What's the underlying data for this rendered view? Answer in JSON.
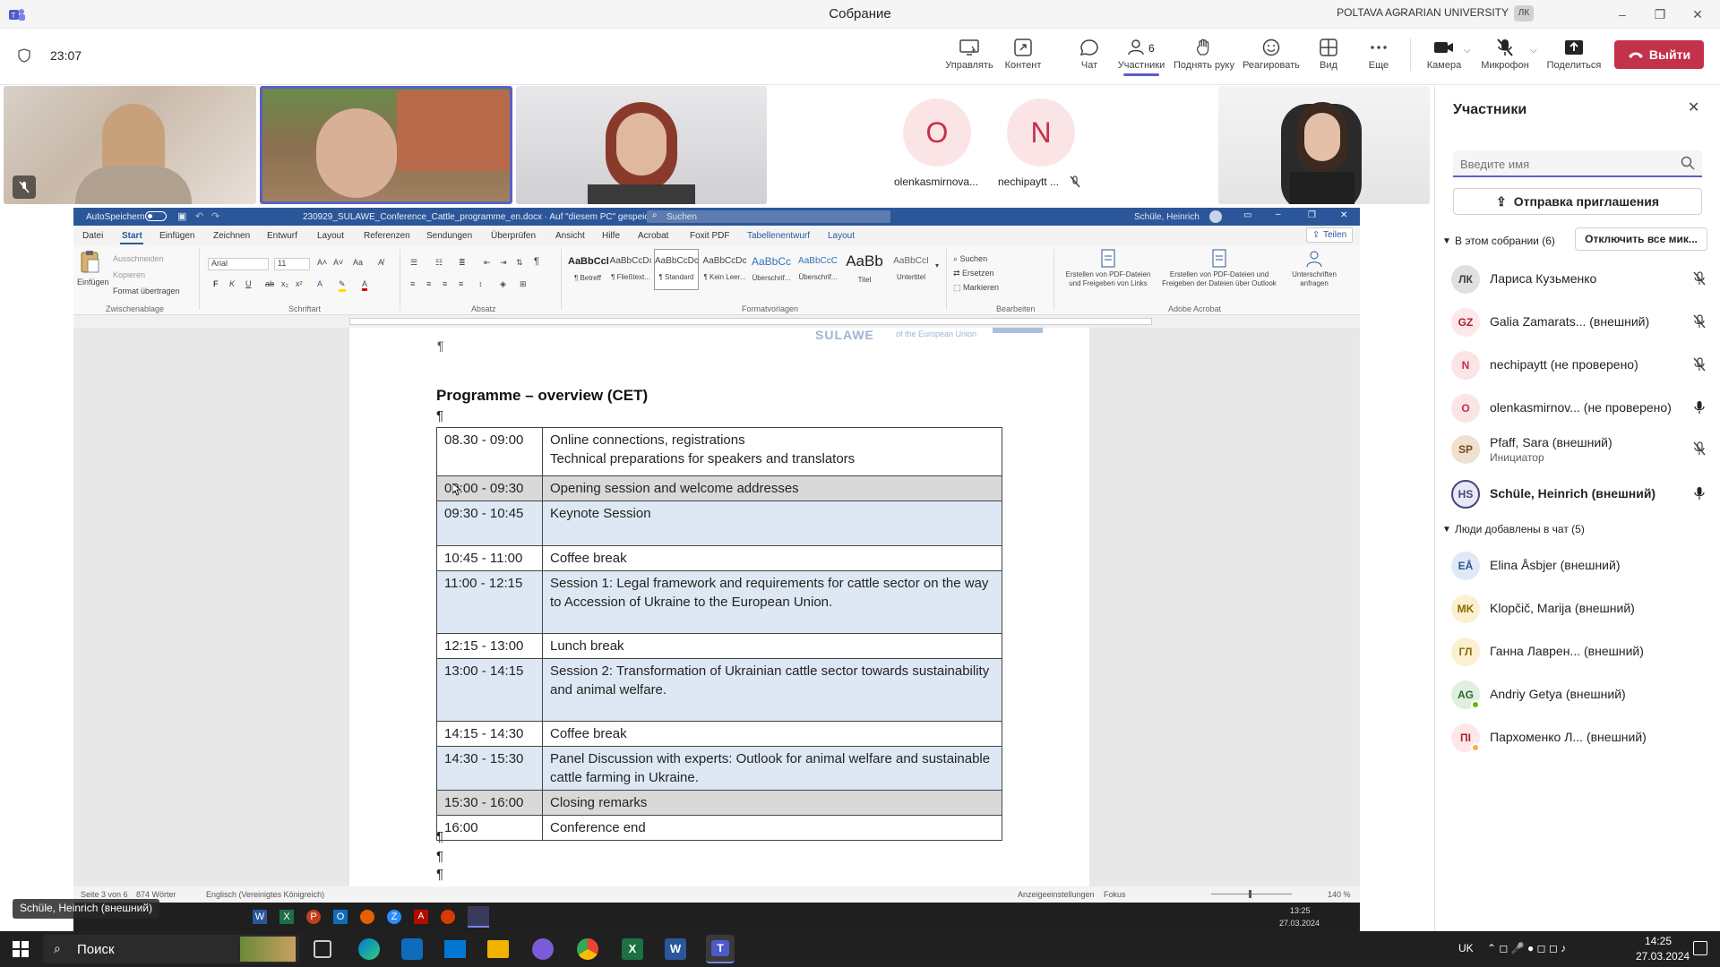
{
  "app": {
    "title": "Собрание",
    "org": "POLTAVA AGRARIAN UNIVERSITY",
    "org_badge": "ЛК"
  },
  "meeting": {
    "timer": "23:07",
    "toolbar": {
      "manage": "Управлять",
      "content": "Контент",
      "chat": "Чат",
      "participants": "Участники",
      "participants_count": "6",
      "raise_hand": "Поднять руку",
      "react": "Реагировать",
      "view": "Вид",
      "more": "Еще",
      "camera": "Камера",
      "mic": "Микрофон",
      "share": "Поделиться",
      "leave": "Выйти"
    },
    "tiles": [
      {
        "initial": "O",
        "name": "olenkasmirnova..."
      },
      {
        "initial": "N",
        "name": "nechipaytt ..."
      }
    ],
    "presenter_label": "Schüle, Heinrich (внешний)"
  },
  "panel": {
    "title": "Участники",
    "search_placeholder": "Введите имя",
    "invite_button": "Отправка приглашения",
    "in_meeting_header": "В этом собрании (6)",
    "mute_all_button": "Отключить все мик...",
    "in_meeting": [
      {
        "initials": "ЛК",
        "name": "Лариса Кузьменко",
        "sub": "",
        "bg": "#e0e0e0",
        "fg": "#424242",
        "mic": "muted"
      },
      {
        "initials": "GZ",
        "name": "Galia Zamarats... (внешний)",
        "sub": "",
        "bg": "#fde7e9",
        "fg": "#a4262c",
        "mic": "muted"
      },
      {
        "initials": "N",
        "name": "nechipaytt (не проверено)",
        "sub": "",
        "bg": "#fbe4e6",
        "fg": "#c4314b",
        "mic": "muted"
      },
      {
        "initials": "O",
        "name": "olenkasmirnov... (не проверено)",
        "sub": "",
        "bg": "#fbe4e6",
        "fg": "#c4314b",
        "mic": "on"
      },
      {
        "initials": "SP",
        "name": "Pfaff, Sara (внешний)",
        "sub": "Инициатор",
        "bg": "#f0e0d0",
        "fg": "#7a4a1a",
        "mic": "muted"
      },
      {
        "initials": "HS",
        "name": "Schüle, Heinrich (внешний)",
        "sub": "",
        "bg": "#e8e8f8",
        "fg": "#464775",
        "mic": "on"
      }
    ],
    "chat_header": "Люди добавлены в чат (5)",
    "chat_people": [
      {
        "initials": "EÅ",
        "name": "Elina Åsbjer (внешний)",
        "bg": "#e0eaf6",
        "fg": "#2b579a"
      },
      {
        "initials": "MK",
        "name": "Klopčič, Marija (внешний)",
        "bg": "#fbf0d0",
        "fg": "#8a6a00"
      },
      {
        "initials": "ГЛ",
        "name": "Ганна Лаврен... (внешний)",
        "bg": "#fbf0d0",
        "fg": "#8a6a00"
      },
      {
        "initials": "AG",
        "name": "Andriy Getya (внешний)",
        "bg": "#e0f0e0",
        "fg": "#2a6a2a"
      },
      {
        "initials": "ПІ",
        "name": "Пархоменко Л... (внешний)",
        "bg": "#fde7e9",
        "fg": "#a4262c"
      }
    ]
  },
  "word": {
    "autosave": "AutoSpeichern",
    "filename": "230929_SULAWE_Conference_Cattle_programme_en.docx · Auf \"diesem PC\" gespeichert",
    "search": "Suchen",
    "user": "Schüle, Heinrich",
    "share": "Teilen",
    "menu": [
      "Datei",
      "Start",
      "Einfügen",
      "Zeichnen",
      "Entwurf",
      "Layout",
      "Referenzen",
      "Sendungen",
      "Überprüfen",
      "Ansicht",
      "Hilfe",
      "Acrobat",
      "Foxit PDF",
      "Tabellenentwurf",
      "Layout"
    ],
    "ribbon": {
      "paste": "Einfügen",
      "cut": "Ausschneiden",
      "copy": "Kopieren",
      "format_painter": "Format übertragen",
      "clipboard": "Zwischenablage",
      "font": "Arial",
      "size": "11",
      "font_group": "Schriftart",
      "paragraph_group": "Absatz",
      "styles_group": "Formatvorlagen",
      "edit_group": "Bearbeiten",
      "find": "Suchen",
      "replace": "Ersetzen",
      "select": "Markieren",
      "pdf1": "Erstellen von PDF-Dateien und Freigeben von Links",
      "pdf2": "Erstellen von PDF-Dateien und Freigeben der Dateien über Outlook",
      "sign": "Unterschriften anfragen",
      "acrobat_group": "Adobe Acrobat",
      "styles": [
        {
          "preview": "AaBbCcl",
          "name": "¶ Betreff"
        },
        {
          "preview": "AaBbCcDı",
          "name": "¶ Fließtext..."
        },
        {
          "preview": "AaBbCcDc",
          "name": "¶ Standard"
        },
        {
          "preview": "AaBbCcDc",
          "name": "¶ Kein Leer..."
        },
        {
          "preview": "AaBbCc",
          "name": "Überschrif..."
        },
        {
          "preview": "AaBbCcC",
          "name": "Überschrif..."
        },
        {
          "preview": "AaBb",
          "name": "Titel"
        },
        {
          "preview": "AaBbCcI",
          "name": "Untertitel"
        }
      ]
    },
    "doc": {
      "logo": "SULAWE",
      "logo_sub": "of the European Union",
      "heading": "Programme – overview (CET)",
      "rows": [
        {
          "time": "08.30 - 09:00",
          "lines": [
            "Online connections, registrations",
            "Technical preparations for speakers and translators"
          ],
          "style": "plain"
        },
        {
          "time": "09:00 - 09:30",
          "lines": [
            "Opening session and welcome addresses"
          ],
          "style": "gray"
        },
        {
          "time": "09:30 - 10:45",
          "lines": [
            "Keynote Session",
            ""
          ],
          "style": "blue"
        },
        {
          "time": "10:45 - 11:00",
          "lines": [
            "Coffee break"
          ],
          "style": "plain"
        },
        {
          "time": "11:00 - 12:15",
          "lines": [
            "Session 1: Legal framework and requirements for cattle sector on the way to Accession of Ukraine to the European Union.",
            ""
          ],
          "style": "blue"
        },
        {
          "time": "12:15 - 13:00",
          "lines": [
            "Lunch break"
          ],
          "style": "plain"
        },
        {
          "time": "13:00 - 14:15",
          "lines": [
            "Session 2: Transformation of Ukrainian cattle sector towards sustainability and animal welfare.",
            ""
          ],
          "style": "blue"
        },
        {
          "time": "14:15 - 14:30",
          "lines": [
            "Coffee break"
          ],
          "style": "plain"
        },
        {
          "time": "14:30 - 15:30",
          "lines": [
            "Panel Discussion with experts: Outlook for animal welfare and sustainable cattle farming in Ukraine."
          ],
          "style": "blue"
        },
        {
          "time": "15:30 - 16:00",
          "lines": [
            "Closing remarks"
          ],
          "style": "gray"
        },
        {
          "time": "16:00",
          "lines": [
            "Conference end"
          ],
          "style": "plain"
        }
      ]
    },
    "status": {
      "page": "Seite 3 von 6",
      "words": "874 Wörter",
      "lang": "Englisch (Vereinigtes Königreich)",
      "display": "Anzeigeeinstellungen",
      "focus": "Fokus",
      "zoom": "140 %"
    },
    "inner_clock": {
      "time": "13:25",
      "date": "27.03.2024"
    }
  },
  "taskbar": {
    "search": "Поиск",
    "lang": "UK",
    "time": "14:25",
    "date": "27.03.2024"
  }
}
